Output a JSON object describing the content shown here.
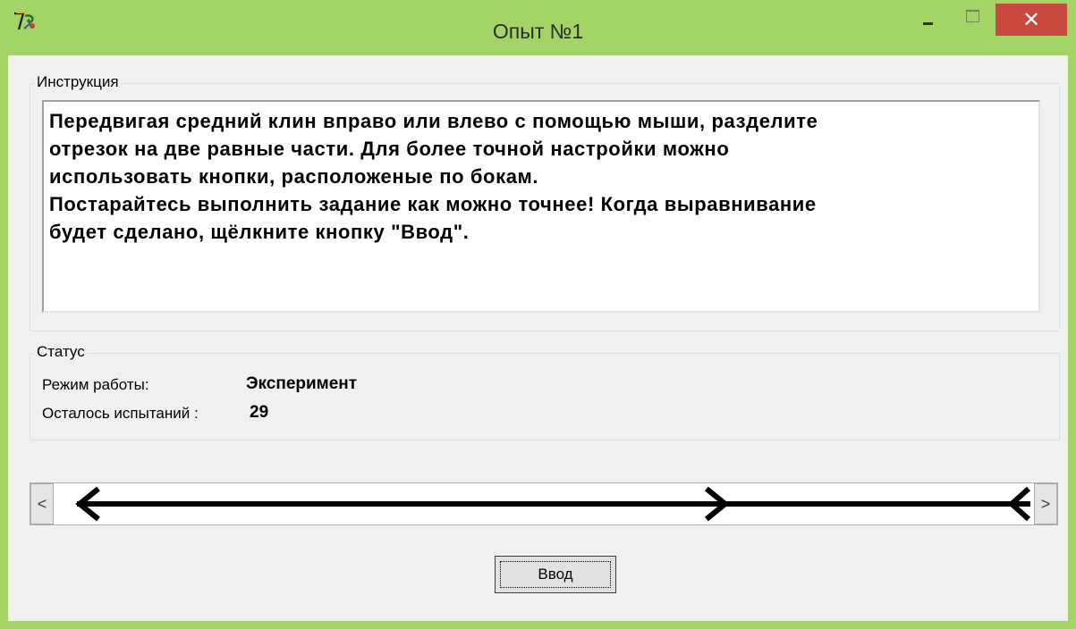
{
  "window": {
    "title": "Опыт №1",
    "icon": "app-logo-icon",
    "close_glyph": "✕"
  },
  "instruction": {
    "label": "Инструкция",
    "lines": [
      "Передвигая средний клин вправо или влево с помощью мыши, разделите",
      "отрезок на две равные части. Для более точной настройки можно",
      "использовать кнопки, расположеные по бокам.",
      "Постарайтесь выполнить задание как можно точнее! Когда выравнивание",
      "будет сделано, щёлкните кнопку \"Ввод\"."
    ]
  },
  "status": {
    "label": "Статус",
    "mode_label": "Режим работы:",
    "mode_value": "Эксперимент",
    "trials_label": "Осталось испытаний :",
    "trials_value": "29"
  },
  "slider": {
    "left_arrow": "<",
    "right_arrow": ">",
    "middle_wedge_fraction": 0.68
  },
  "buttons": {
    "enter_label": "Ввод"
  },
  "colors": {
    "title_bar": "#a4d466",
    "close_button": "#c7493f",
    "panel": "#f0f0f0"
  }
}
